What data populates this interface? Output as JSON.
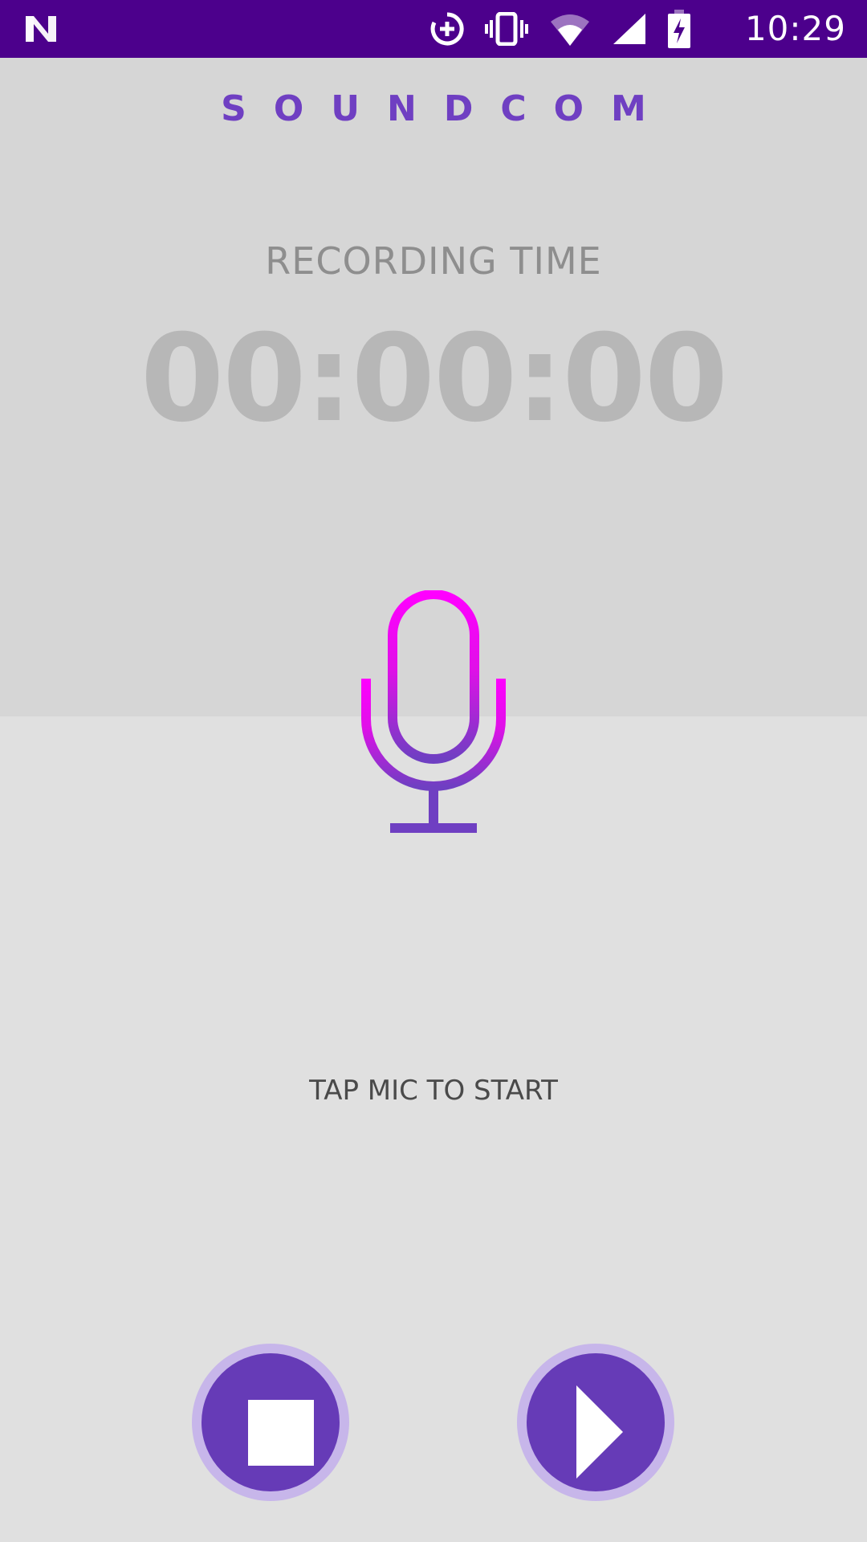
{
  "status_bar": {
    "time": "10:29",
    "icons": [
      "n-logo-icon",
      "data-saver-icon",
      "vibrate-icon",
      "wifi-icon",
      "signal-icon",
      "battery-charging-icon"
    ],
    "background": "#4c008c"
  },
  "app": {
    "title": "SOUNDCOM",
    "accent": "#6f3fc2"
  },
  "recorder": {
    "label": "RECORDING TIME",
    "time": "00:00:00",
    "hint": "TAP MIC TO START",
    "mic_icon": "microphone-icon",
    "mic_gradient": [
      "#ff00ff",
      "#6f3fc2"
    ]
  },
  "controls": {
    "stop_icon": "stop-icon",
    "play_icon": "play-icon",
    "button_color": "#663bb7"
  }
}
